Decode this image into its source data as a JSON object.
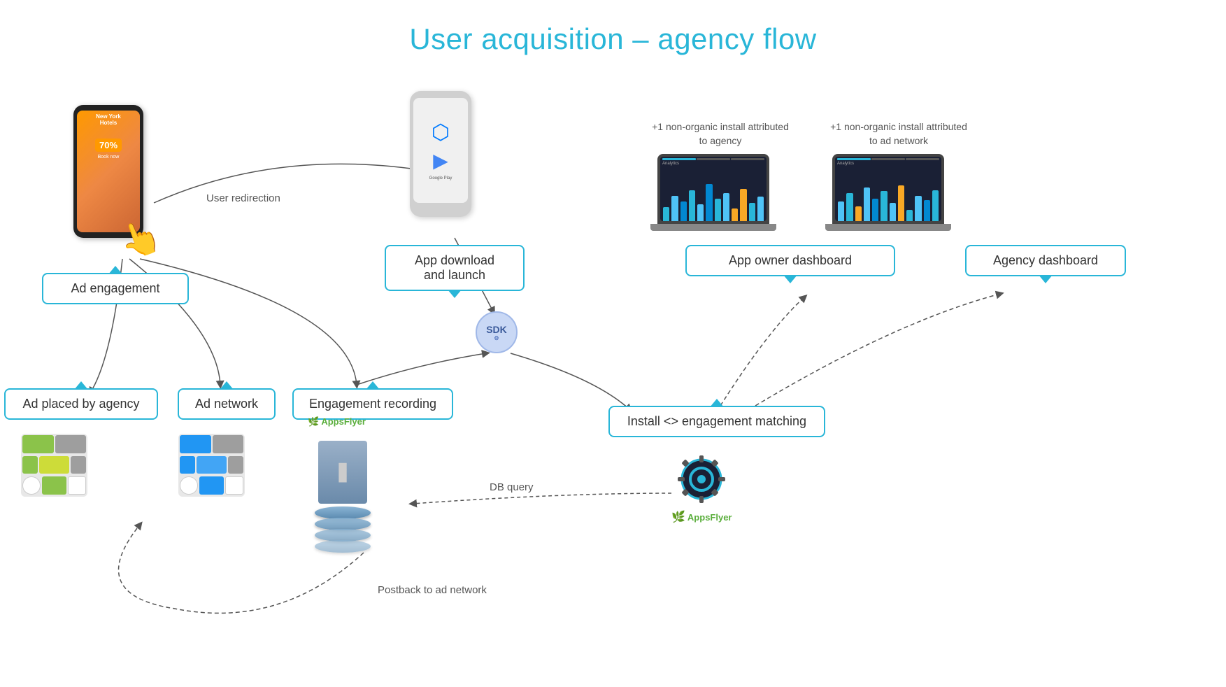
{
  "title": "User acquisition – agency flow",
  "callouts": {
    "ad_engagement": "Ad engagement",
    "app_download": "App download\nand launch",
    "ad_placed_by_agency": "Ad placed by agency",
    "ad_network": "Ad network",
    "engagement_recording": "Engagement recording",
    "install_matching": "Install <> engagement matching",
    "app_owner_dashboard": "App owner dashboard",
    "agency_dashboard": "Agency dashboard"
  },
  "labels": {
    "user_redirection": "User redirection",
    "db_query": "DB query",
    "postback": "Postback to ad network",
    "non_organic_agency": "+1 non-organic install\nattributed to agency",
    "non_organic_ad_network": "+1 non-organic install\nattributed to ad network"
  },
  "appsflyer_brand": "AppsFlyer",
  "sdk_label": "SDK"
}
